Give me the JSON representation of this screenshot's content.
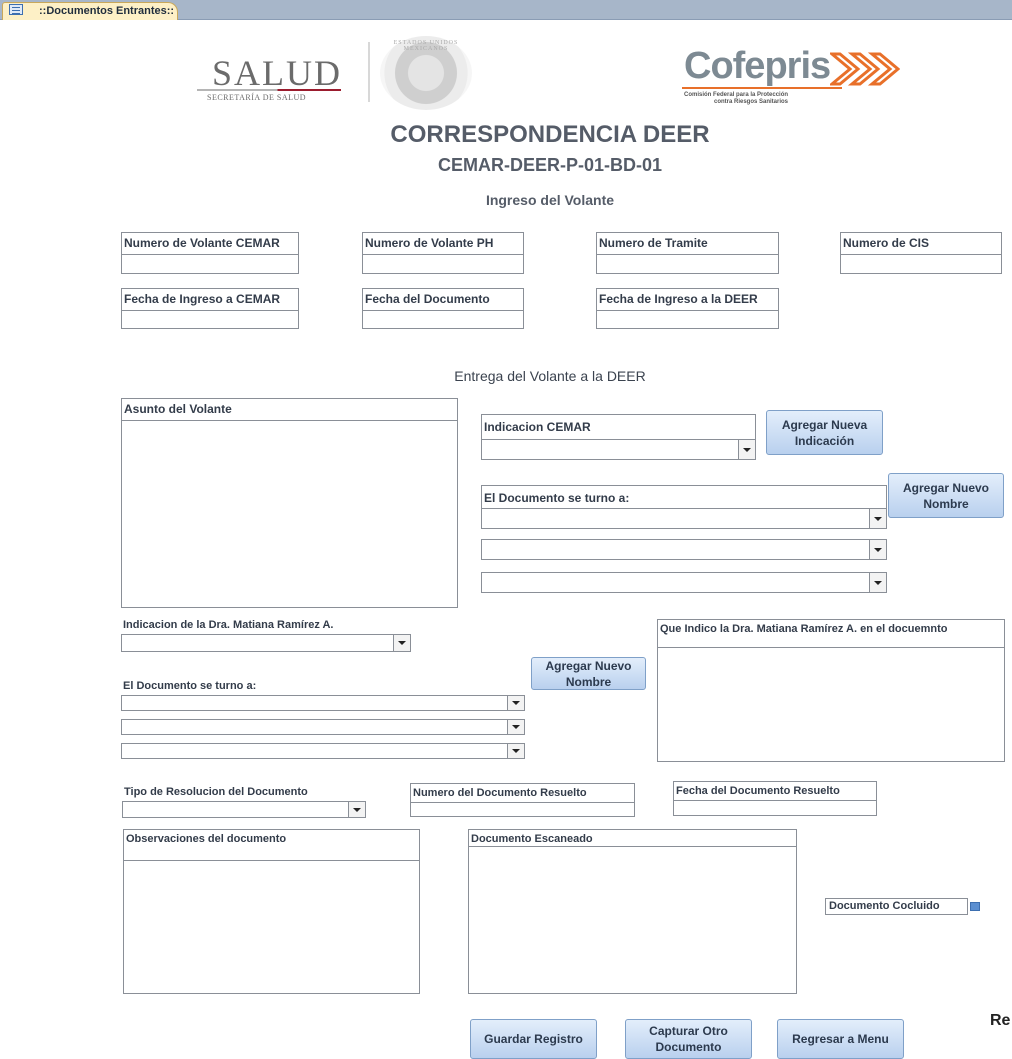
{
  "tab": {
    "title": "::Documentos Entrantes::"
  },
  "logos": {
    "salud": "SALUD",
    "salud_sub": "SECRETARÍA DE SALUD",
    "seal_text": "ESTADOS UNIDOS MEXICANOS",
    "cofepris": "Cofepris",
    "cofepris_sub1": "Comisión Federal para la Protección",
    "cofepris_sub2": "contra Riesgos Sanitarios"
  },
  "headings": {
    "title": "CORRESPONDENCIA DEER",
    "code": "CEMAR-DEER-P-01-BD-01",
    "section1": "Ingreso del Volante",
    "section2": "Entrega del Volante a la DEER"
  },
  "fields": {
    "volante_cemar": "Numero de Volante CEMAR",
    "volante_ph": "Numero de Volante PH",
    "tramite": "Numero de Tramite",
    "cis": "Numero de CIS",
    "fecha_ingreso_cemar": "Fecha de Ingreso a CEMAR",
    "fecha_documento": "Fecha del Documento",
    "fecha_ingreso_deer": "Fecha de Ingreso a la DEER",
    "asunto": "Asunto del Volante",
    "indicacion_cemar": "Indicacion CEMAR",
    "turno_1": "El Documento se turno a:",
    "indicacion_dra": "Indicacion de la Dra. Matiana Ramírez A.",
    "turno_2": "El Documento se turno a:",
    "que_indico": "Que Indico la Dra. Matiana Ramírez A. en el docuemnto",
    "tipo_resolucion": "Tipo de Resolucion del Documento",
    "numero_resuelto": "Numero del Documento Resuelto",
    "fecha_resuelto": "Fecha del Documento Resuelto",
    "observaciones": "Observaciones del documento",
    "escaneado": "Documento Escaneado",
    "concluido": "Documento Cocluido"
  },
  "buttons": {
    "agregar_indicacion": "Agregar Nueva Indicación",
    "agregar_nombre_1": "Agregar Nuevo Nombre",
    "agregar_nombre_2": "Agregar Nuevo Nombre",
    "guardar": "Guardar Registro",
    "capturar": "Capturar Otro Documento",
    "regresar": "Regresar a Menu"
  },
  "edge_text": "Re",
  "colors": {
    "button_top": "#e3eefb",
    "button_bottom": "#b9d0ee",
    "tab_bg": "#fdf0c6",
    "strip_bg": "#a7b6c9"
  }
}
